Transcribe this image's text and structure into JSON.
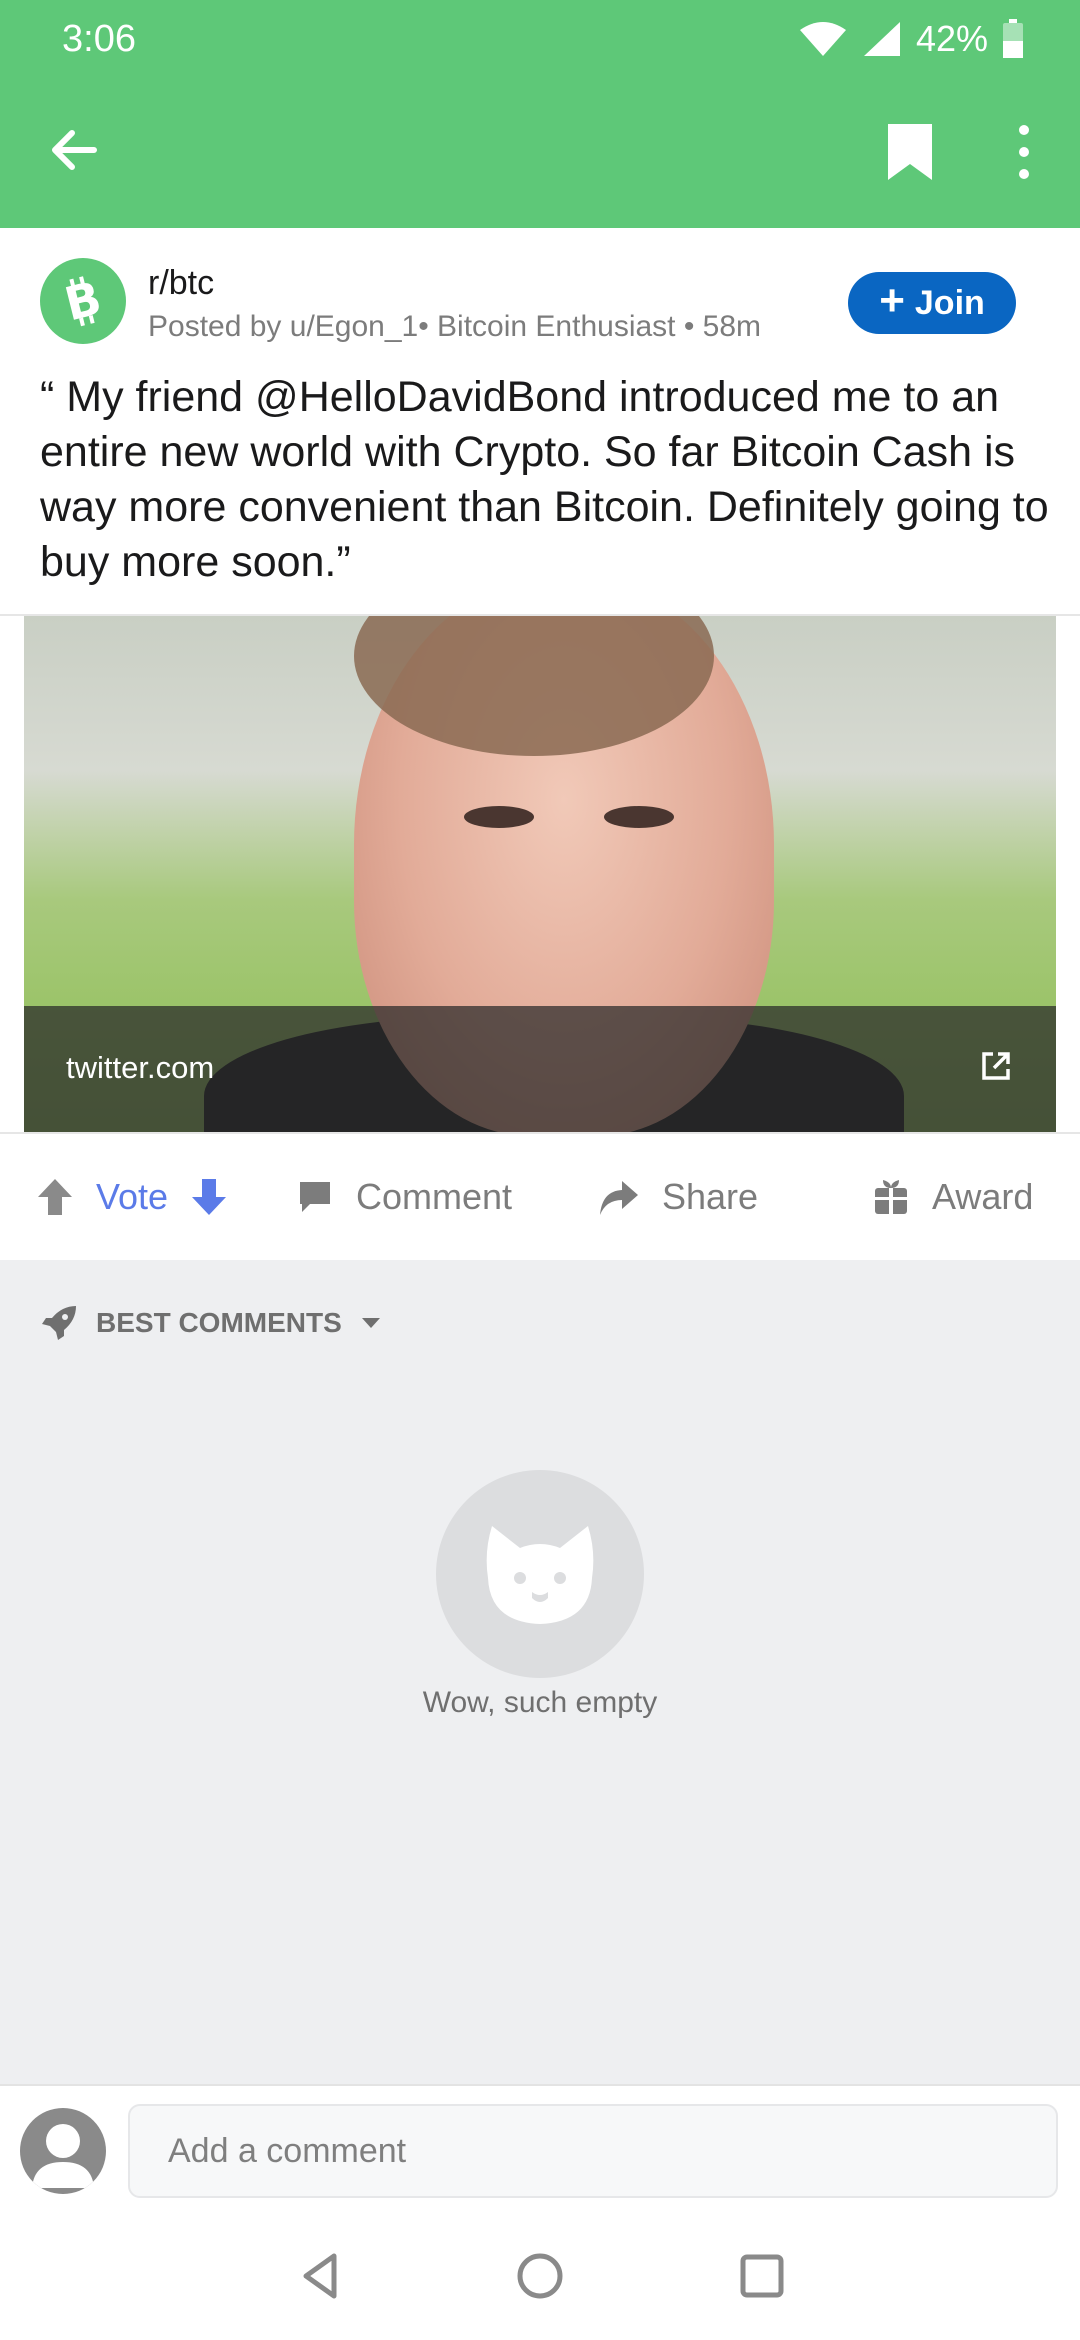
{
  "status": {
    "time": "3:06",
    "battery": "42%"
  },
  "app": {
    "accent": "#5ec878"
  },
  "post": {
    "subreddit": "r/btc",
    "posted_line": "Posted by u/Egon_1• Bitcoin Enthusiast • 58m",
    "join_label": "Join",
    "title": "“ My friend @HelloDavidBond introduced me to an entire new world with Crypto. So far Bitcoin Cash is way more convenient than Bitcoin. Definitely going to buy more soon.”",
    "link_domain": "twitter.com"
  },
  "actions": {
    "vote": "Vote",
    "comment": "Comment",
    "share": "Share",
    "award": "Award"
  },
  "comments": {
    "sort_label": "BEST COMMENTS",
    "empty_text": "Wow, such empty"
  },
  "composer": {
    "placeholder": "Add a comment"
  }
}
